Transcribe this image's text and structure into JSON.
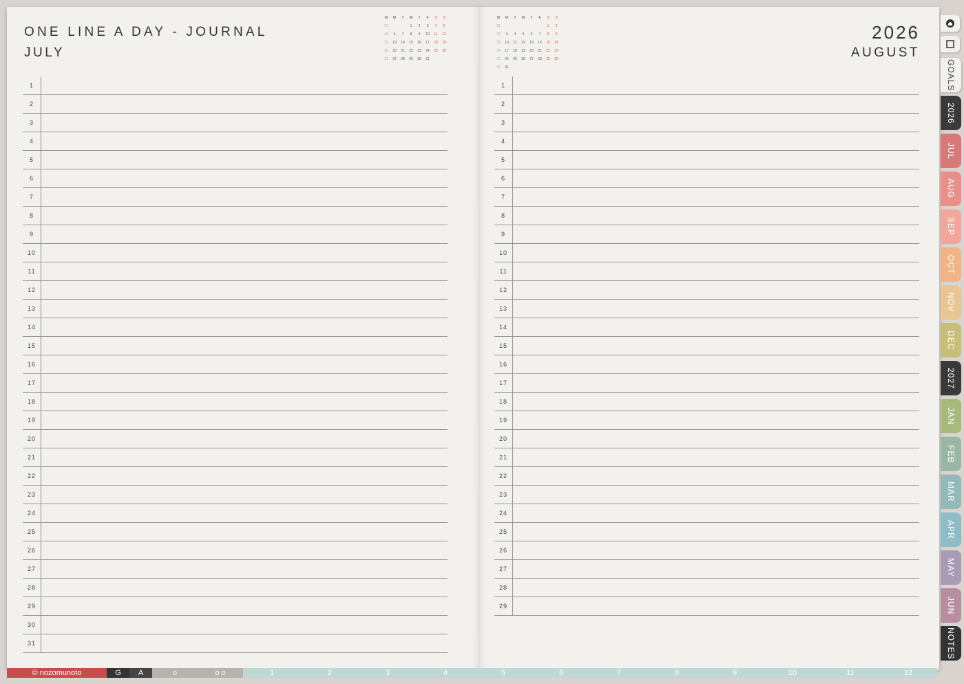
{
  "left_page": {
    "title": "ONE LINE A DAY - JOURNAL",
    "month": "JULY",
    "days": [
      "1",
      "2",
      "3",
      "4",
      "5",
      "6",
      "7",
      "8",
      "9",
      "10",
      "11",
      "12",
      "13",
      "14",
      "15",
      "16",
      "17",
      "18",
      "19",
      "20",
      "21",
      "22",
      "23",
      "24",
      "25",
      "26",
      "27",
      "28",
      "29",
      "30",
      "31"
    ],
    "calendar": {
      "headers": [
        "W",
        "M",
        "T",
        "W",
        "T",
        "F",
        "S",
        "S"
      ],
      "rows": [
        [
          "27",
          "",
          "",
          "1",
          "2",
          "3",
          "4",
          "5"
        ],
        [
          "28",
          "6",
          "7",
          "8",
          "9",
          "10",
          "11",
          "12"
        ],
        [
          "29",
          "13",
          "14",
          "15",
          "16",
          "17",
          "18",
          "19"
        ],
        [
          "30",
          "20",
          "21",
          "22",
          "23",
          "24",
          "25",
          "26"
        ],
        [
          "31",
          "27",
          "28",
          "29",
          "30",
          "31",
          "",
          ""
        ]
      ]
    }
  },
  "right_page": {
    "year": "2026",
    "month": "AUGUST",
    "days": [
      "1",
      "2",
      "3",
      "4",
      "5",
      "6",
      "7",
      "8",
      "9",
      "10",
      "11",
      "12",
      "13",
      "14",
      "15",
      "16",
      "17",
      "18",
      "19",
      "20",
      "21",
      "22",
      "23",
      "24",
      "25",
      "26",
      "27",
      "28",
      "29"
    ],
    "calendar": {
      "headers": [
        "W",
        "M",
        "T",
        "W",
        "T",
        "F",
        "S",
        "S"
      ],
      "rows": [
        [
          "31",
          "",
          "",
          "",
          "",
          "",
          "1",
          "2"
        ],
        [
          "32",
          "3",
          "4",
          "5",
          "6",
          "7",
          "8",
          "9"
        ],
        [
          "33",
          "10",
          "11",
          "12",
          "13",
          "14",
          "15",
          "16"
        ],
        [
          "34",
          "17",
          "18",
          "19",
          "20",
          "21",
          "22",
          "23"
        ],
        [
          "35",
          "24",
          "25",
          "26",
          "27",
          "28",
          "29",
          "30"
        ],
        [
          "36",
          "31",
          "",
          "",
          "",
          "",
          "",
          ""
        ]
      ]
    }
  },
  "side_tabs": [
    {
      "label": "GOALS",
      "color": "#f3f1ee",
      "text": "#444"
    },
    {
      "label": "2026",
      "color": "#3a3a3a",
      "text": "#fff"
    },
    {
      "label": "JUL",
      "color": "#d87878",
      "text": "#fff"
    },
    {
      "label": "AUG",
      "color": "#e98f8a",
      "text": "#fff"
    },
    {
      "label": "SEP",
      "color": "#f0a79a",
      "text": "#fff"
    },
    {
      "label": "OCT",
      "color": "#f0b487",
      "text": "#fff"
    },
    {
      "label": "NOV",
      "color": "#e8c592",
      "text": "#fff"
    },
    {
      "label": "DEC",
      "color": "#c8bd79",
      "text": "#fff"
    },
    {
      "label": "2027",
      "color": "#3a3a3a",
      "text": "#fff"
    },
    {
      "label": "JAN",
      "color": "#a9b97d",
      "text": "#fff"
    },
    {
      "label": "FEB",
      "color": "#9ab7a6",
      "text": "#fff"
    },
    {
      "label": "MAR",
      "color": "#93b9b8",
      "text": "#fff"
    },
    {
      "label": "APR",
      "color": "#8fbcc8",
      "text": "#fff"
    },
    {
      "label": "MAY",
      "color": "#a99ab6",
      "text": "#fff"
    },
    {
      "label": "JUN",
      "color": "#b88d9f",
      "text": "#fff"
    },
    {
      "label": "NOTES",
      "color": "#333333",
      "text": "#fff"
    }
  ],
  "bottom_bar": {
    "brand": "© nozomunoto",
    "items": [
      {
        "label": "G",
        "color": "#333333"
      },
      {
        "label": "A",
        "color": "#444444"
      },
      {
        "label": "o",
        "color": "#b7b3ad"
      },
      {
        "label": "o o",
        "color": "#b7b3ad"
      },
      {
        "label": "1",
        "color": "#bfd8d6"
      },
      {
        "label": "2",
        "color": "#bfd8d6"
      },
      {
        "label": "3",
        "color": "#bfd8d6"
      },
      {
        "label": "4",
        "color": "#bfd8d6"
      },
      {
        "label": "5",
        "color": "#bfd8d6"
      },
      {
        "label": "6",
        "color": "#bfd8d6"
      },
      {
        "label": "7",
        "color": "#bfd8d6"
      },
      {
        "label": "8",
        "color": "#bfd8d6"
      },
      {
        "label": "9",
        "color": "#bfd8d6"
      },
      {
        "label": "10",
        "color": "#bfd8d6"
      },
      {
        "label": "11",
        "color": "#bfd8d6"
      },
      {
        "label": "12",
        "color": "#bfd8d6"
      }
    ]
  },
  "icons": {
    "home": "home-icon",
    "page": "page-icon"
  }
}
